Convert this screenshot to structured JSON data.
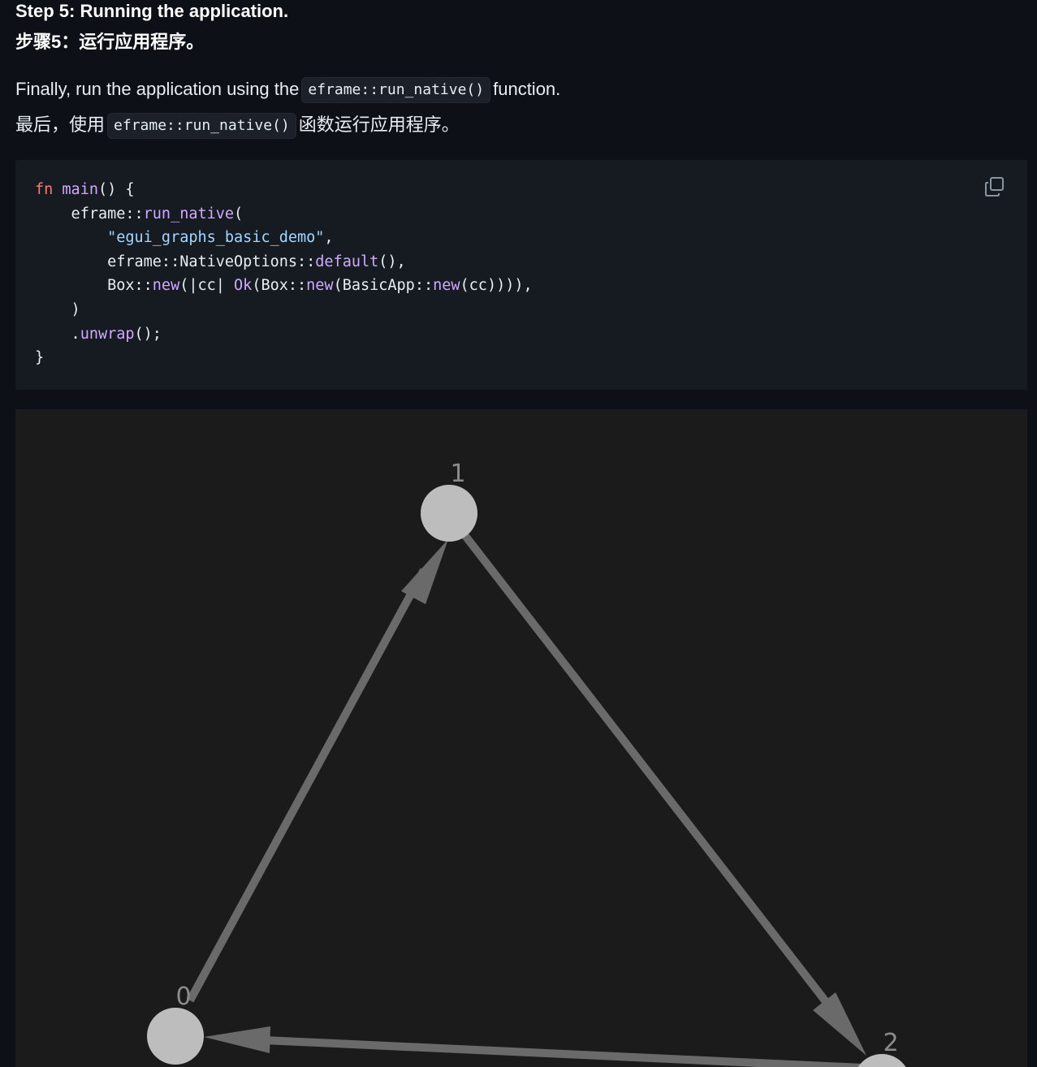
{
  "step": {
    "title_en": "Step 5: Running the application.",
    "title_zh": "步骤5：运行应用程序。"
  },
  "paragraph_en": {
    "before": "Finally, run the application using the",
    "code": "eframe::run_native()",
    "after": "function."
  },
  "paragraph_zh": {
    "before": "最后，使用",
    "code": "eframe::run_native()",
    "after": "函数运行应用程序。"
  },
  "code_block": {
    "language": "rust",
    "copy_icon": "copy-icon",
    "lines": [
      [
        {
          "t": "fn",
          "k": "kw"
        },
        {
          "t": " ",
          "k": "plain"
        },
        {
          "t": "main",
          "k": "fn"
        },
        {
          "t": "() {",
          "k": "plain"
        }
      ],
      [
        {
          "t": "    eframe::",
          "k": "plain"
        },
        {
          "t": "run_native",
          "k": "fn"
        },
        {
          "t": "(",
          "k": "plain"
        }
      ],
      [
        {
          "t": "        ",
          "k": "plain"
        },
        {
          "t": "\"egui_graphs_basic_demo\"",
          "k": "str"
        },
        {
          "t": ",",
          "k": "plain"
        }
      ],
      [
        {
          "t": "        eframe::NativeOptions::",
          "k": "plain"
        },
        {
          "t": "default",
          "k": "fn"
        },
        {
          "t": "(),",
          "k": "plain"
        }
      ],
      [
        {
          "t": "        Box::",
          "k": "plain"
        },
        {
          "t": "new",
          "k": "fn"
        },
        {
          "t": "(|cc| ",
          "k": "plain"
        },
        {
          "t": "Ok",
          "k": "fn"
        },
        {
          "t": "(Box::",
          "k": "plain"
        },
        {
          "t": "new",
          "k": "fn"
        },
        {
          "t": "(BasicApp::",
          "k": "plain"
        },
        {
          "t": "new",
          "k": "fn"
        },
        {
          "t": "(cc)))),",
          "k": "plain"
        }
      ],
      [
        {
          "t": "    )",
          "k": "plain"
        }
      ],
      [
        {
          "t": "    .",
          "k": "plain"
        },
        {
          "t": "unwrap",
          "k": "fn"
        },
        {
          "t": "();",
          "k": "plain"
        }
      ],
      [
        {
          "t": "}",
          "k": "plain"
        }
      ]
    ]
  },
  "graph": {
    "nodes": [
      {
        "id": "1",
        "label": "1"
      },
      {
        "id": "0",
        "label": "0"
      },
      {
        "id": "2",
        "label": "2"
      }
    ],
    "edges": [
      {
        "from": "0",
        "to": "1"
      },
      {
        "from": "1",
        "to": "2"
      },
      {
        "from": "2",
        "to": "0"
      }
    ],
    "colors": {
      "background": "#1b1b1b",
      "node": "#bdbdbd",
      "edge": "#6a6a6a",
      "label": "#8c8c8c"
    }
  },
  "colors": {
    "page_background": "#0d1117",
    "code_background": "#161b22",
    "keyword": "#ff7b72",
    "function": "#d2a8ff",
    "string": "#a5d6ff"
  }
}
